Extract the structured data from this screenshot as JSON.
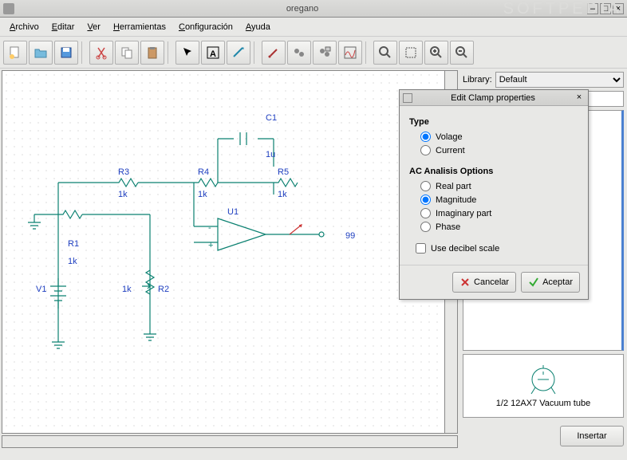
{
  "window": {
    "title": "oregano",
    "minimize": "–",
    "maximize": "□",
    "close": "×"
  },
  "menu": {
    "file": "Archivo",
    "edit": "Editar",
    "view": "Ver",
    "tools": "Herramientas",
    "config": "Configuración",
    "help": "Ayuda"
  },
  "sidebar": {
    "library_label": "Library:",
    "library_value": "Default",
    "preview_name": "1/2 12AX7 Vacuum tube",
    "insert": "Insertar"
  },
  "dialog": {
    "title": "Edit Clamp properties",
    "type_label": "Type",
    "type_voltage": "Volage",
    "type_current": "Current",
    "ac_label": "AC Analisis Options",
    "ac_real": "Real part",
    "ac_magnitude": "Magnitude",
    "ac_imaginary": "Imaginary part",
    "ac_phase": "Phase",
    "decibel": "Use decibel scale",
    "cancel": "Cancelar",
    "accept": "Aceptar",
    "type_selected": "voltage",
    "ac_selected": "magnitude",
    "decibel_checked": false
  },
  "circuit": {
    "C1": {
      "label": "C1",
      "value": "1u"
    },
    "R1": {
      "label": "R1",
      "value": "1k"
    },
    "R2": {
      "label": "R2",
      "value": "1k"
    },
    "R3": {
      "label": "R3",
      "value": "1k"
    },
    "R4": {
      "label": "R4",
      "value": "1k"
    },
    "R5": {
      "label": "R5",
      "value": "1k"
    },
    "U1": {
      "label": "U1"
    },
    "V1": {
      "label": "V1"
    },
    "node99": "99"
  },
  "watermark": "SOFTPEDIA"
}
